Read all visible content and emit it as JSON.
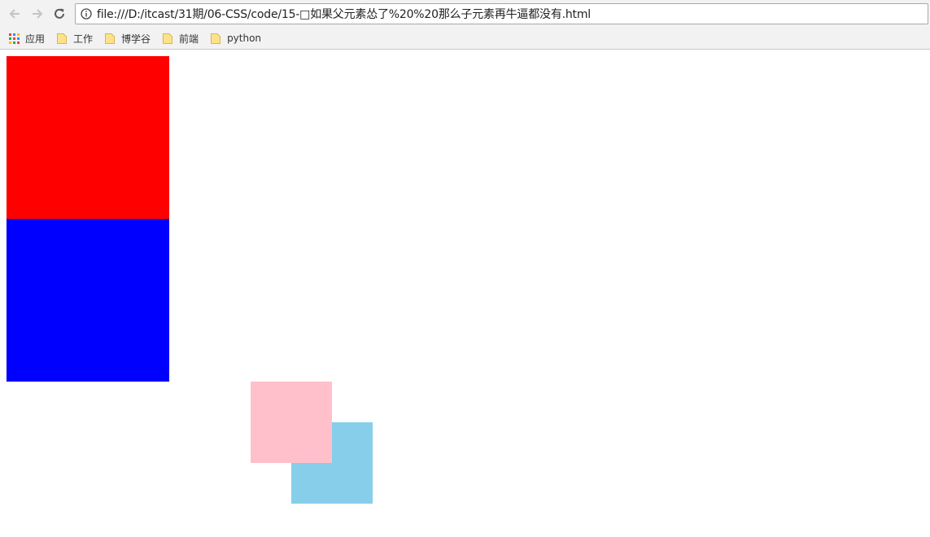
{
  "browser": {
    "address": {
      "url": "file:///D:/itcast/31期/06-CSS/code/15-□如果父元素怂了%20%20那么子元素再牛逼都没有.html"
    },
    "icons": {
      "back": "back-arrow-icon",
      "forward": "forward-arrow-icon",
      "reload": "reload-icon",
      "info": "info-icon"
    }
  },
  "bookmarks": {
    "items": [
      {
        "label": "应用",
        "icon": "apps-grid-icon"
      },
      {
        "label": "工作",
        "icon": "folder-icon"
      },
      {
        "label": "博学谷",
        "icon": "folder-icon"
      },
      {
        "label": "前端",
        "icon": "folder-icon"
      },
      {
        "label": "python",
        "icon": "folder-icon"
      }
    ]
  },
  "page": {
    "boxes": [
      {
        "name": "red",
        "color": "#ff0000"
      },
      {
        "name": "blue",
        "color": "#0000ff"
      },
      {
        "name": "skyblue",
        "color": "#87ceeb"
      },
      {
        "name": "pink",
        "color": "#ffc0cb"
      }
    ]
  }
}
